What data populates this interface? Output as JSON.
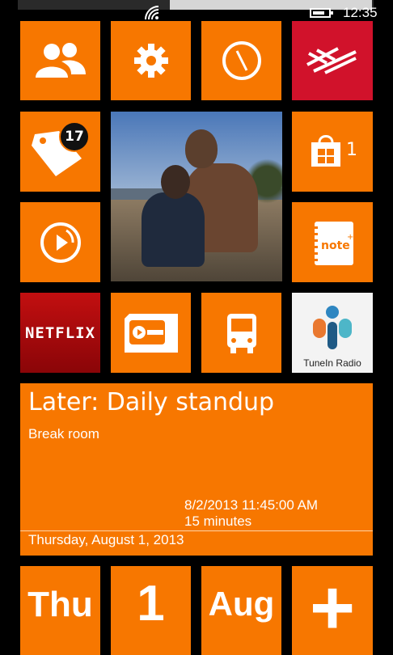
{
  "status": {
    "time": "12:35",
    "battery_level": 0.75
  },
  "tiles": {
    "people": {
      "icon": "people-icon"
    },
    "settings": {
      "icon": "gear-icon"
    },
    "browser": {
      "icon": "compass-icon"
    },
    "bank": {
      "icon": "bank-flag-icon",
      "color": "#d1122b"
    },
    "tag": {
      "icon": "tag-icon",
      "badge": "17"
    },
    "photo": {
      "icon": "photo"
    },
    "store": {
      "icon": "store-bag-icon",
      "count": "1"
    },
    "music": {
      "icon": "music-play-icon"
    },
    "note": {
      "icon": "note-icon",
      "label": "note"
    },
    "netflix": {
      "label": "NETFLIX",
      "color": "#c20f10"
    },
    "podcast": {
      "icon": "cassette-icon"
    },
    "transit": {
      "icon": "bus-icon"
    },
    "tunein": {
      "icon": "tunein-logo-icon",
      "label": "TuneIn Radio"
    }
  },
  "calendar": {
    "title": "Later: Daily standup",
    "location": "Break room",
    "datetime": "8/2/2013 11:45:00 AM",
    "duration": "15 minutes",
    "date": "Thursday, August 1, 2013"
  },
  "bottom_tiles": {
    "day": "Thu",
    "date": "1",
    "month": "Aug",
    "add": "+"
  },
  "colors": {
    "accent": "#f77700",
    "background": "#000000"
  }
}
